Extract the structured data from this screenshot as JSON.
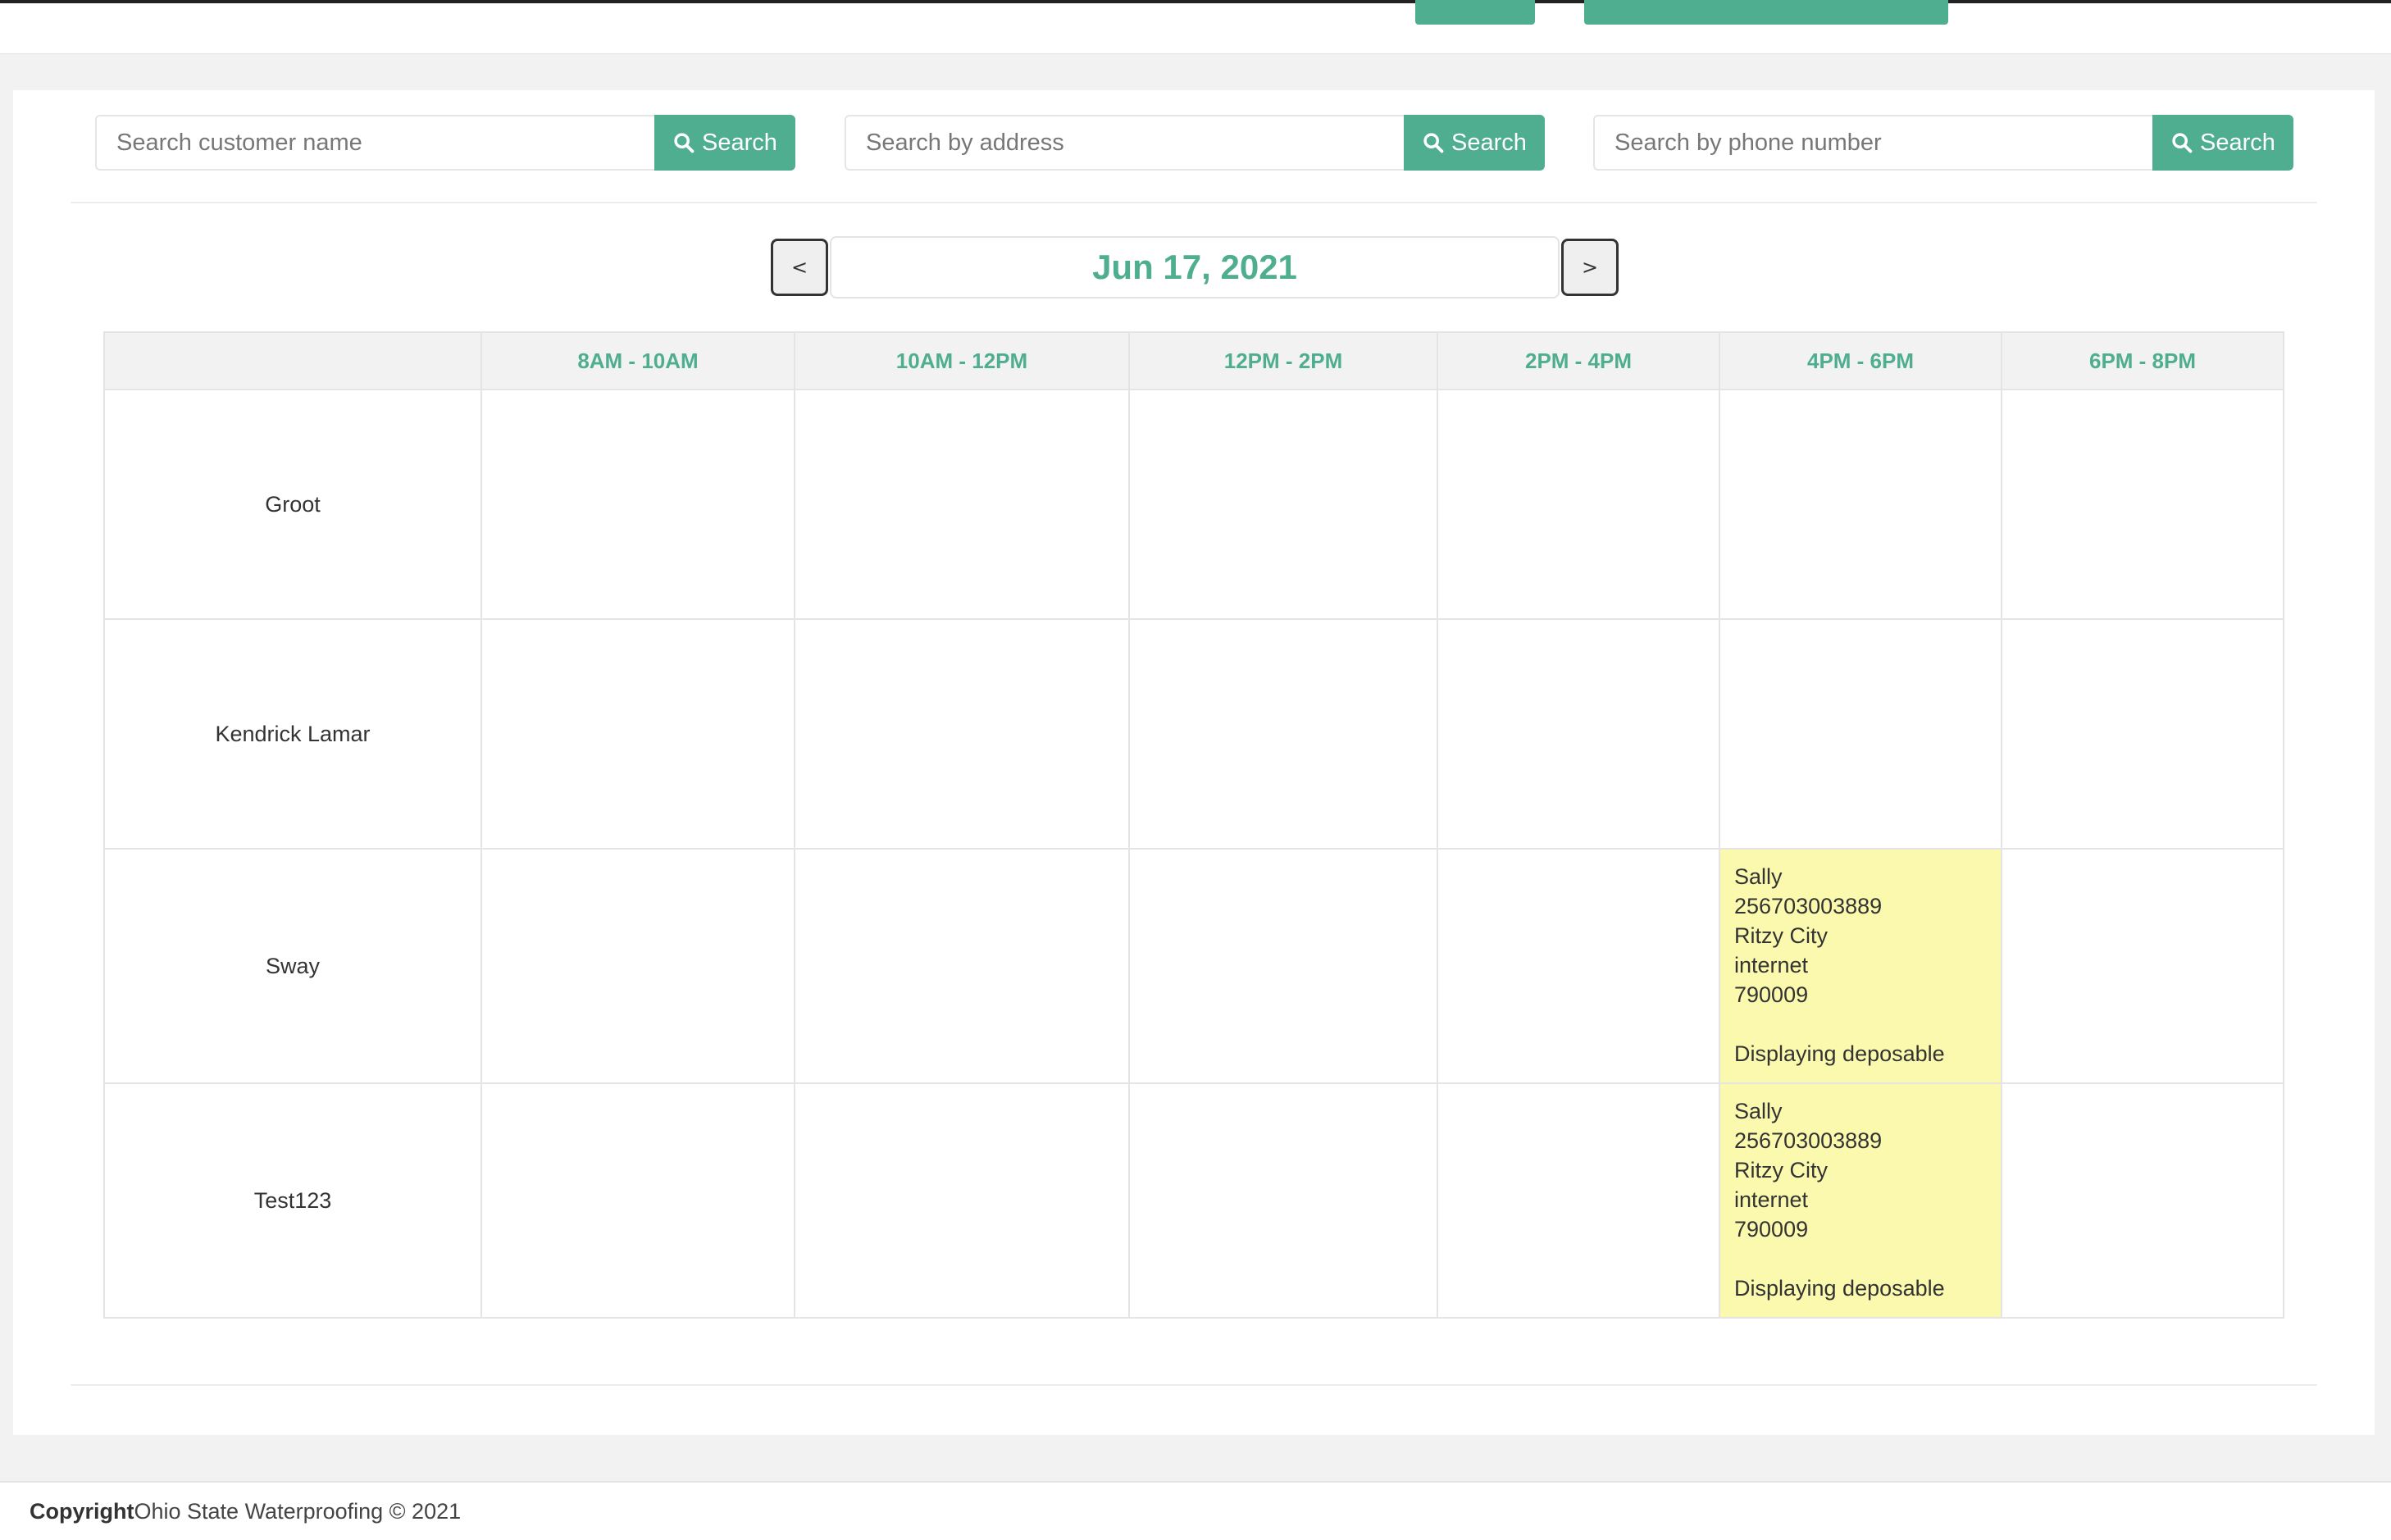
{
  "search": {
    "customer": {
      "placeholder": "Search customer name",
      "button": "Search"
    },
    "address": {
      "placeholder": "Search by address",
      "button": "Search"
    },
    "phone": {
      "placeholder": "Search by phone number",
      "button": "Search"
    }
  },
  "date_nav": {
    "prev": "<",
    "date": "Jun 17, 2021",
    "next": ">"
  },
  "schedule": {
    "columns": [
      "",
      "8AM - 10AM",
      "10AM - 12PM",
      "12PM - 2PM",
      "2PM - 4PM",
      "4PM - 6PM",
      "6PM - 8PM"
    ],
    "rows": [
      {
        "name": "Groot"
      },
      {
        "name": "Kendrick Lamar"
      },
      {
        "name": "Sway",
        "appointment": {
          "slot": "4PM - 6PM",
          "customer": "Sally",
          "phone": "256703003889",
          "city": "Ritzy City",
          "source": "internet",
          "zip": "790009",
          "blank": "",
          "note": "Displaying deposable"
        }
      },
      {
        "name": "Test123",
        "appointment": {
          "slot": "4PM - 6PM",
          "customer": "Sally",
          "phone": "256703003889",
          "city": "Ritzy City",
          "source": "internet",
          "zip": "790009",
          "blank": "",
          "note": "Displaying deposable"
        }
      }
    ]
  },
  "footer": {
    "copyright_label": "Copyright",
    "text": "Ohio State Waterproofing © 2021"
  },
  "colors": {
    "accent": "#4fae8f",
    "booked": "#fbf9ad"
  },
  "icons": {
    "search": "search-icon"
  }
}
